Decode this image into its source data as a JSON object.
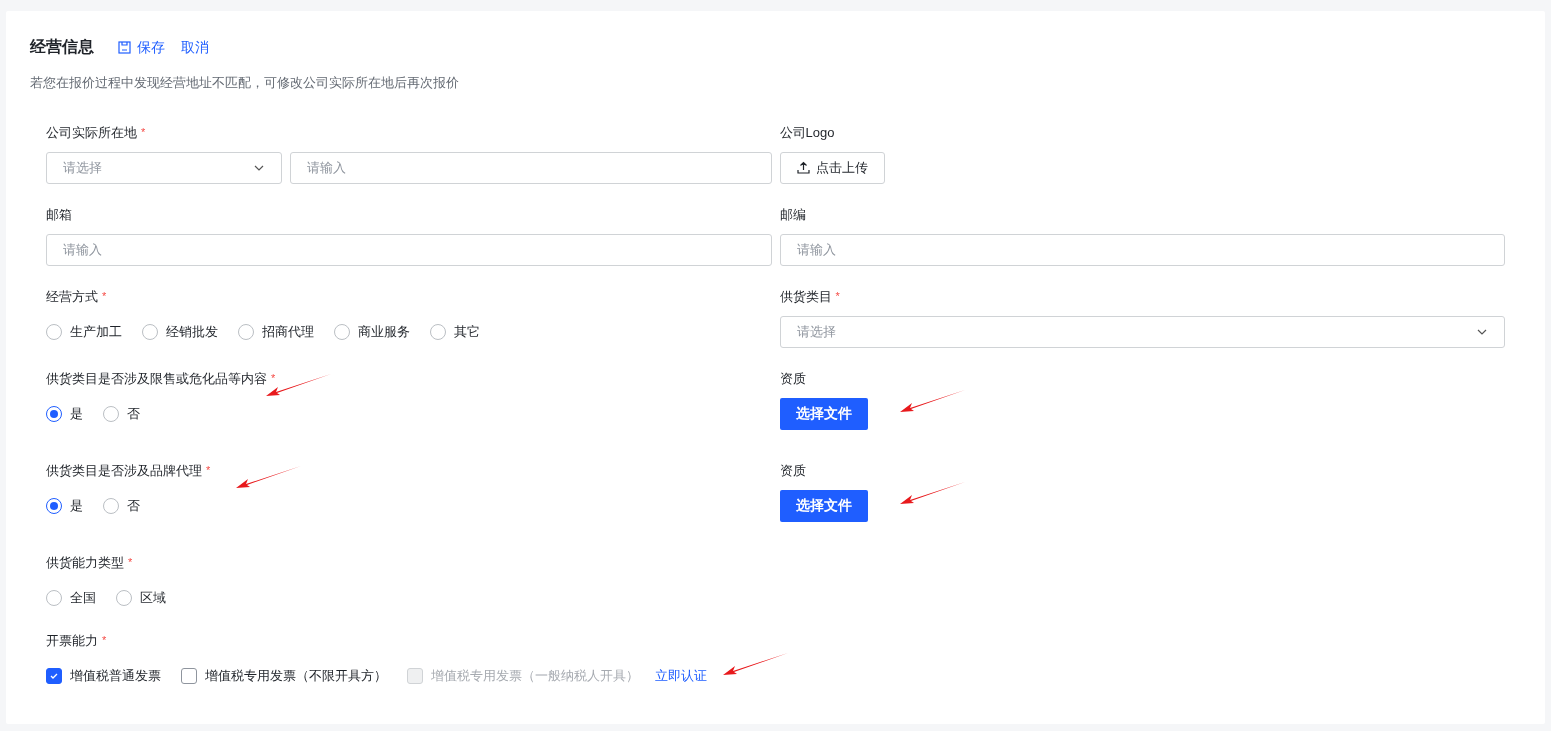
{
  "header": {
    "title": "经营信息",
    "actions": [
      {
        "kind": "save",
        "label": "保存"
      },
      {
        "kind": "plain",
        "label": "取消"
      }
    ],
    "hint": "若您在报价过程中发现经营地址不匹配，可修改公司实际所在地后再次报价"
  },
  "rows": [
    {
      "fields": [
        {
          "kind": "location",
          "label": "公司实际所在地",
          "required": "*",
          "select_placeholder": "请选择",
          "input_placeholder": "请输入"
        },
        {
          "kind": "upload",
          "label": "公司Logo",
          "button": "点击上传"
        }
      ]
    },
    {
      "fields": [
        {
          "kind": "input",
          "label": "邮箱",
          "placeholder": "请输入"
        },
        {
          "kind": "input",
          "label": "邮编",
          "placeholder": "请输入"
        }
      ]
    },
    {
      "fields": [
        {
          "kind": "radios",
          "label": "经营方式",
          "required": "*",
          "options": [
            {
              "label": "生产加工",
              "selected": false
            },
            {
              "label": "经销批发",
              "selected": false
            },
            {
              "label": "招商代理",
              "selected": false
            },
            {
              "label": "商业服务",
              "selected": false
            },
            {
              "label": "其它",
              "selected": false
            }
          ]
        },
        {
          "kind": "select",
          "label": "供货类目",
          "required": "*",
          "placeholder": "请选择"
        }
      ]
    },
    {
      "fields": [
        {
          "kind": "radios",
          "label": "供货类目是否涉及限售或危化品等内容",
          "required": "*",
          "annotated": true,
          "options": [
            {
              "label": "是",
              "selected": true
            },
            {
              "label": "否",
              "selected": false
            }
          ]
        },
        {
          "kind": "file",
          "label": "资质",
          "annotated": true,
          "button": "选择文件"
        }
      ]
    },
    {
      "fields": [
        {
          "kind": "radios",
          "label": "供货类目是否涉及品牌代理",
          "required": "*",
          "annotated": true,
          "options": [
            {
              "label": "是",
              "selected": true
            },
            {
              "label": "否",
              "selected": false
            }
          ]
        },
        {
          "kind": "file",
          "label": "资质",
          "annotated": true,
          "button": "选择文件"
        }
      ]
    },
    {
      "fields": [
        {
          "kind": "radios",
          "label": "供货能力类型",
          "required": "*",
          "options": [
            {
              "label": "全国",
              "selected": false
            },
            {
              "label": "区域",
              "selected": false
            }
          ]
        }
      ]
    },
    {
      "fields": [
        {
          "kind": "checks",
          "label": "开票能力",
          "required": "*",
          "annotated": true,
          "options": [
            {
              "label": "增值税普通发票",
              "checked": true,
              "disabled": false
            },
            {
              "label": "增值税专用发票（不限开具方）",
              "checked": false,
              "disabled": false
            },
            {
              "label": "增值税专用发票（一般纳税人开具）",
              "checked": false,
              "disabled": true
            }
          ],
          "link": "立即认证"
        }
      ]
    }
  ]
}
